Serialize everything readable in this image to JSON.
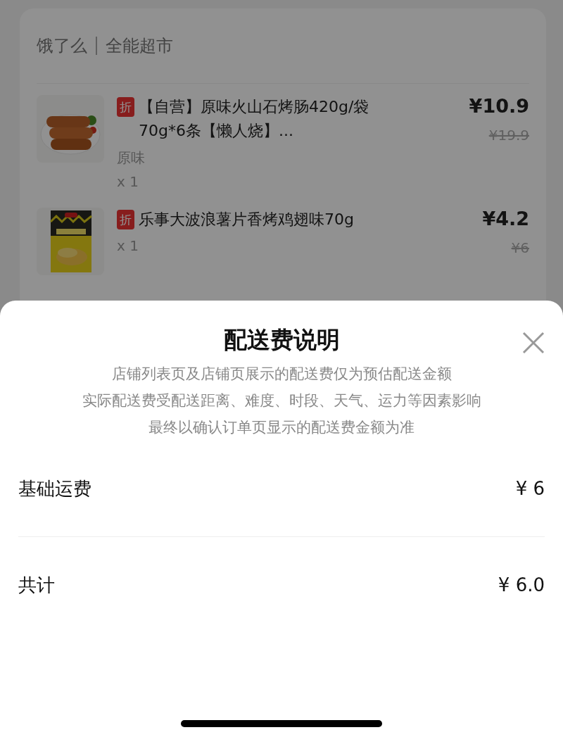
{
  "store": {
    "platform": "饿了么",
    "name": "全能超市"
  },
  "items": [
    {
      "kind": "picture",
      "badge": "折",
      "title": "【自营】原味火山石烤肠420g/袋 70g*6条【懒人烧】...",
      "spec": "原味",
      "quantity": "x 1",
      "price": "¥10.9",
      "original_price": "¥19.9"
    },
    {
      "kind": "picture",
      "badge": "折",
      "title": "乐事大波浪薯片香烤鸡翅味70g",
      "quantity": "x 1",
      "price": "¥4.2",
      "original_price": "¥6"
    }
  ],
  "sheet": {
    "title": "配送费说明",
    "description": [
      "店铺列表页及店铺页展示的配送费仅为预估配送金额",
      "实际配送费受配送距离、难度、时段、天气、运力等因素影响",
      "最终以确认订单页显示的配送费金额为准"
    ],
    "rows": [
      {
        "label": "基础运费",
        "value": "¥ 6"
      },
      {
        "label": "共计",
        "value": "¥ 6.0"
      }
    ]
  }
}
